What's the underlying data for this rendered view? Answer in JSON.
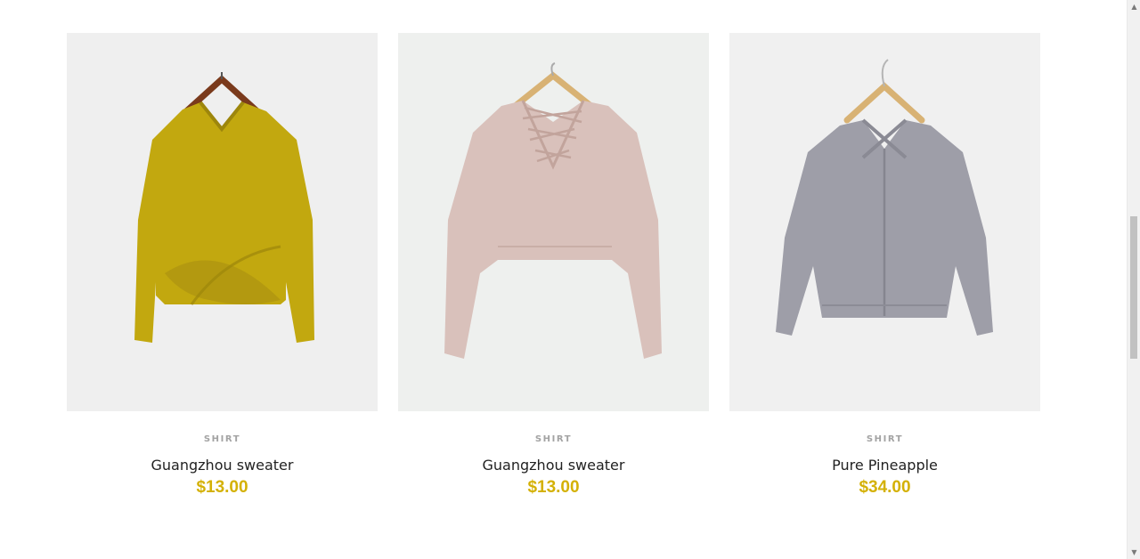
{
  "accent_color": "#d4b106",
  "products": [
    {
      "category": "SHIRT",
      "name": "Guangzhou sweater",
      "price": "$13.00",
      "image": "mustard-twist-sweater"
    },
    {
      "category": "SHIRT",
      "name": "Guangzhou sweater",
      "price": "$13.00",
      "image": "pink-lace-up-sweater"
    },
    {
      "category": "SHIRT",
      "name": "Pure Pineapple",
      "price": "$34.00",
      "image": "grey-cross-back-cardigan"
    }
  ],
  "icons": {
    "scroll_up": "scroll-up-arrow-icon",
    "scroll_down": "scroll-down-arrow-icon"
  }
}
